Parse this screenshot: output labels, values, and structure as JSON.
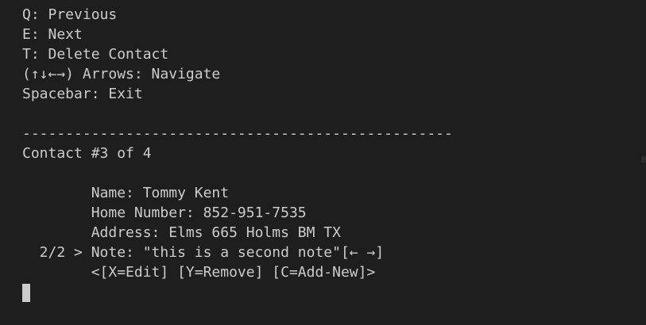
{
  "terminal": {
    "help": [
      "Q: Previous",
      "E: Next",
      "T: Delete Contact",
      "(↑↓←→) Arrows: Navigate",
      "Spacebar: Exit"
    ],
    "separator": "--------------------------------------------------",
    "contact_header": "Contact #3 of 4",
    "fields": {
      "name": "        Name: Tommy Kent",
      "home_number": "        Home Number: 852-951-7535",
      "address": "        Address: Elms 665 Holms BM TX",
      "note": "  2/2 > Note: \"this is a second note\"[← →]",
      "actions": "        <[X=Edit] [Y=Remove] [C=Add-New]>"
    }
  }
}
